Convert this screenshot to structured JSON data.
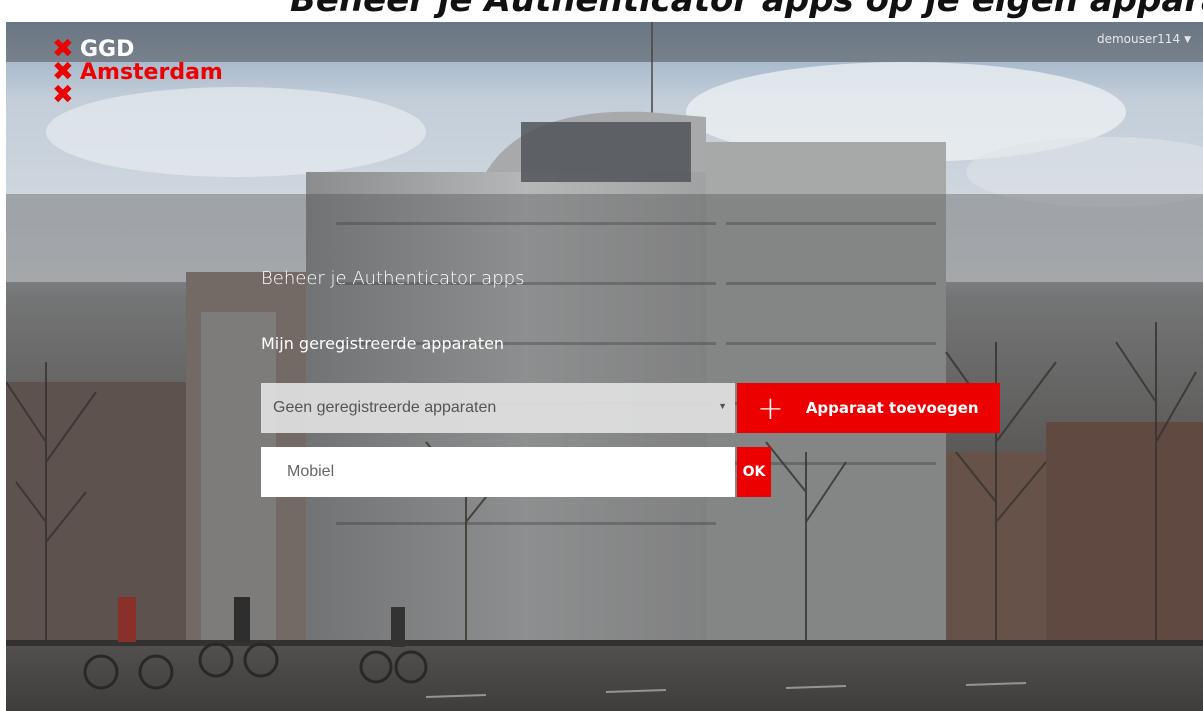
{
  "header": {
    "cropped_caption": "Beheer je Authenticator apps op je eigen apparaat",
    "username": "demouser114",
    "user_menu_icon": "caret-down-icon"
  },
  "logo": {
    "mark_icon": "andreas-cross-icon",
    "line1": "GGD",
    "line2": "Amsterdam"
  },
  "main": {
    "title": "Beheer je Authenticator apps",
    "subtitle": "Mijn geregistreerde apparaten",
    "device_select": {
      "value": "Geen geregistreerde apparaten",
      "icon": "caret-down-icon"
    },
    "add_button": {
      "icon": "plus-icon",
      "label": "Apparaat toevoegen"
    },
    "name_input": {
      "placeholder": "Mobiel",
      "value": ""
    },
    "ok_button": {
      "label": "OK"
    }
  },
  "colors": {
    "accent": "#ec0000",
    "text_light": "#ffffff"
  }
}
